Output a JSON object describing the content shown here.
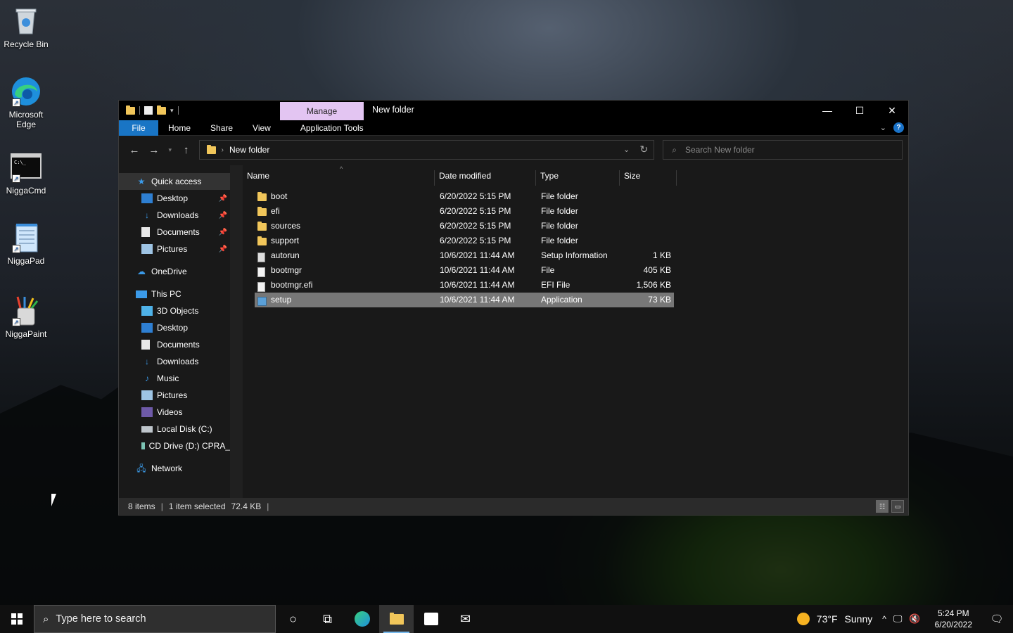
{
  "desktop": {
    "icons": [
      {
        "label": "Recycle Bin"
      },
      {
        "label": "Microsoft Edge"
      },
      {
        "label": "NiggaCmd"
      },
      {
        "label": "NiggaPad"
      },
      {
        "label": "NiggaPaint"
      }
    ]
  },
  "window": {
    "title": "New folder",
    "manage_tab": "Manage",
    "controls": {
      "minimize": "—",
      "maximize": "☐",
      "close": "✕"
    },
    "ribbon_tabs": [
      "File",
      "Home",
      "Share",
      "View",
      "Application Tools"
    ],
    "address": {
      "path": "New folder"
    },
    "search": {
      "placeholder": "Search New folder"
    },
    "nav_pane": {
      "quick_access": "Quick access",
      "quick_items": [
        "Desktop",
        "Downloads",
        "Documents",
        "Pictures"
      ],
      "onedrive": "OneDrive",
      "this_pc": "This PC",
      "pc_items": [
        "3D Objects",
        "Desktop",
        "Documents",
        "Downloads",
        "Music",
        "Pictures",
        "Videos",
        "Local Disk (C:)",
        "CD Drive (D:) CPRA_"
      ],
      "network": "Network"
    },
    "columns": [
      "Name",
      "Date modified",
      "Type",
      "Size"
    ],
    "files": [
      {
        "name": "boot",
        "date": "6/20/2022 5:15 PM",
        "type": "File folder",
        "size": ""
      },
      {
        "name": "efi",
        "date": "6/20/2022 5:15 PM",
        "type": "File folder",
        "size": ""
      },
      {
        "name": "sources",
        "date": "6/20/2022 5:15 PM",
        "type": "File folder",
        "size": ""
      },
      {
        "name": "support",
        "date": "6/20/2022 5:15 PM",
        "type": "File folder",
        "size": ""
      },
      {
        "name": "autorun",
        "date": "10/6/2021 11:44 AM",
        "type": "Setup Information",
        "size": "1 KB"
      },
      {
        "name": "bootmgr",
        "date": "10/6/2021 11:44 AM",
        "type": "File",
        "size": "405 KB"
      },
      {
        "name": "bootmgr.efi",
        "date": "10/6/2021 11:44 AM",
        "type": "EFI File",
        "size": "1,506 KB"
      },
      {
        "name": "setup",
        "date": "10/6/2021 11:44 AM",
        "type": "Application",
        "size": "73 KB"
      }
    ],
    "status": {
      "count": "8 items",
      "selected": "1 item selected",
      "size": "72.4 KB"
    }
  },
  "taskbar": {
    "search_placeholder": "Type here to search",
    "weather": {
      "temp": "73°F",
      "condition": "Sunny"
    },
    "clock": {
      "time": "5:24 PM",
      "date": "6/20/2022"
    }
  }
}
